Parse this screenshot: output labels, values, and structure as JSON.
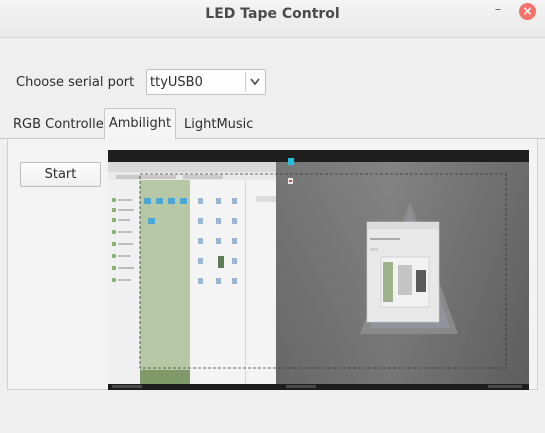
{
  "window": {
    "title": "LED Tape Control",
    "minimize_symbol": "–",
    "close_symbol": "×"
  },
  "serial": {
    "label": "Choose serial port",
    "selected": "ttyUSB0"
  },
  "tabs": [
    {
      "label": "RGB Controller",
      "active": false
    },
    {
      "label": "Ambilight",
      "active": true
    },
    {
      "label": "LightMusic",
      "active": false
    }
  ],
  "ambilight": {
    "start_label": "Start",
    "preview_icon": "screen-capture-preview"
  },
  "colors": {
    "accent_close": "#f5726a",
    "window_bg": "#efefef"
  }
}
